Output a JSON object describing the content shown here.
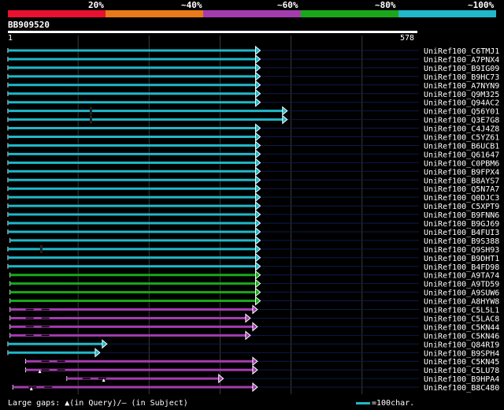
{
  "legend": {
    "labels": [
      "20%",
      "~40%",
      "~60%",
      "~80%",
      "~100%"
    ],
    "colors": [
      "#e8102f",
      "#e87a1a",
      "#a43cb0",
      "#1aa81a",
      "#1fb8c8"
    ]
  },
  "query": {
    "id": "BB909520",
    "start": "1",
    "end": "578",
    "length": 578
  },
  "hits": [
    {
      "name": "UniRef100_C6TMJ1",
      "color": "#1fb8c8",
      "start": 1,
      "end": 350
    },
    {
      "name": "UniRef100_A7PNX4",
      "color": "#1fb8c8",
      "start": 1,
      "end": 350
    },
    {
      "name": "UniRef100_B9IG09",
      "color": "#1fb8c8",
      "start": 1,
      "end": 350
    },
    {
      "name": "UniRef100_B9HC73",
      "color": "#1fb8c8",
      "start": 1,
      "end": 350
    },
    {
      "name": "UniRef100_A7NYN9",
      "color": "#1fb8c8",
      "start": 1,
      "end": 350
    },
    {
      "name": "UniRef100_Q9M325",
      "color": "#1fb8c8",
      "start": 1,
      "end": 350
    },
    {
      "name": "UniRef100_Q94AC2",
      "color": "#1fb8c8",
      "start": 1,
      "end": 350
    },
    {
      "name": "UniRef100_Q56Y01",
      "color": "#1fb8c8",
      "start": 1,
      "end": 388,
      "gap": 118
    },
    {
      "name": "UniRef100_Q3E7G8",
      "color": "#1fb8c8",
      "start": 1,
      "end": 388,
      "gap": 118
    },
    {
      "name": "UniRef100_C4J4Z8",
      "color": "#1fb8c8",
      "start": 1,
      "end": 350
    },
    {
      "name": "UniRef100_C5YZ61",
      "color": "#1fb8c8",
      "start": 1,
      "end": 350
    },
    {
      "name": "UniRef100_B6UCB1",
      "color": "#1fb8c8",
      "start": 1,
      "end": 350
    },
    {
      "name": "UniRef100_Q61647",
      "color": "#1fb8c8",
      "start": 1,
      "end": 350
    },
    {
      "name": "UniRef100_C0PBM6",
      "color": "#1fb8c8",
      "start": 1,
      "end": 350
    },
    {
      "name": "UniRef100_B9FPX4",
      "color": "#1fb8c8",
      "start": 1,
      "end": 350
    },
    {
      "name": "UniRef100_B8AYS7",
      "color": "#1fb8c8",
      "start": 1,
      "end": 350
    },
    {
      "name": "UniRef100_Q5N7A7",
      "color": "#1fb8c8",
      "start": 1,
      "end": 350
    },
    {
      "name": "UniRef100_Q0DJC3",
      "color": "#1fb8c8",
      "start": 1,
      "end": 350
    },
    {
      "name": "UniRef100_C5XPT9",
      "color": "#1fb8c8",
      "start": 1,
      "end": 350
    },
    {
      "name": "UniRef100_B9FNN6",
      "color": "#1fb8c8",
      "start": 1,
      "end": 350
    },
    {
      "name": "UniRef100_B9GJ69",
      "color": "#1fb8c8",
      "start": 1,
      "end": 350
    },
    {
      "name": "UniRef100_B4FUI3",
      "color": "#1fb8c8",
      "start": 1,
      "end": 350
    },
    {
      "name": "UniRef100_B9S388",
      "color": "#1fb8c8",
      "start": 4,
      "end": 350
    },
    {
      "name": "UniRef100_Q9SH93",
      "color": "#1fb8c8",
      "start": 1,
      "end": 350,
      "gap": 48
    },
    {
      "name": "UniRef100_B9DHT1",
      "color": "#1fb8c8",
      "start": 1,
      "end": 350
    },
    {
      "name": "UniRef100_B4FD98",
      "color": "#1fb8c8",
      "start": 1,
      "end": 350
    },
    {
      "name": "UniRef100_A9TA74",
      "color": "#1aa81a",
      "start": 4,
      "end": 350
    },
    {
      "name": "UniRef100_A9TD59",
      "color": "#1aa81a",
      "start": 4,
      "end": 350
    },
    {
      "name": "UniRef100_A9SUW6",
      "color": "#1aa81a",
      "start": 4,
      "end": 350
    },
    {
      "name": "UniRef100_A8HYW8",
      "color": "#1aa81a",
      "start": 4,
      "end": 350
    },
    {
      "name": "UniRef100_C5L5L1",
      "color": "#a43cb0",
      "start": 4,
      "end": 346,
      "dash": true
    },
    {
      "name": "UniRef100_C5LAC8",
      "color": "#a43cb0",
      "start": 4,
      "end": 336,
      "dash": true
    },
    {
      "name": "UniRef100_C5KN44",
      "color": "#a43cb0",
      "start": 4,
      "end": 346,
      "dash": true
    },
    {
      "name": "UniRef100_C5KN46",
      "color": "#a43cb0",
      "start": 4,
      "end": 336,
      "dash": true
    },
    {
      "name": "UniRef100_Q84RI9",
      "color": "#1fb8c8",
      "start": 1,
      "end": 134
    },
    {
      "name": "UniRef100_B9SPH4",
      "color": "#1fb8c8",
      "start": 1,
      "end": 124
    },
    {
      "name": "UniRef100_C5KN45",
      "color": "#a43cb0",
      "start": 26,
      "end": 346,
      "dash": true
    },
    {
      "name": "UniRef100_C5LU78",
      "color": "#a43cb0",
      "start": 26,
      "end": 346,
      "dash": true,
      "mark": 46
    },
    {
      "name": "UniRef100_B9HPA4",
      "color": "#a43cb0",
      "start": 84,
      "end": 298,
      "dash": true,
      "mark": 136
    },
    {
      "name": "UniRef100_B8C480",
      "color": "#a43cb0",
      "start": 8,
      "end": 346,
      "dash": true,
      "mark": 34
    }
  ],
  "footer": {
    "text": "Large gaps: ▲(in Query)/– (in Subject)",
    "scale_label": "=100char."
  }
}
